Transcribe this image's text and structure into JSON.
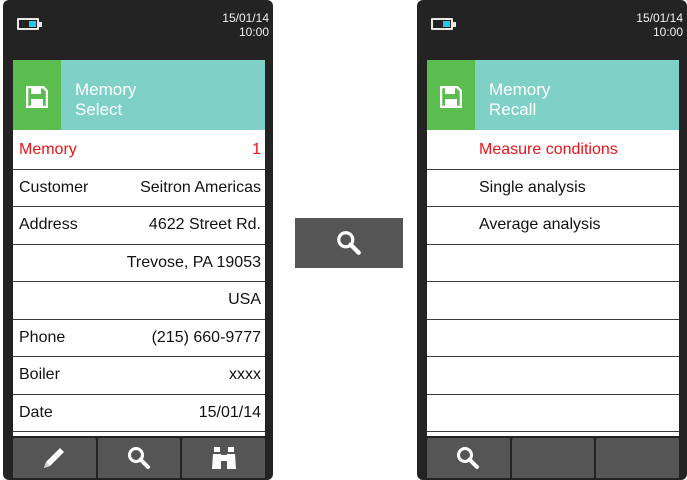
{
  "left_screen": {
    "status": {
      "date": "15/01/14",
      "time": "10:00",
      "battery_icon": "battery-icon"
    },
    "header": {
      "line1": "Memory",
      "line2": "Select",
      "icon": "floppy-disk-icon"
    },
    "rows": [
      {
        "label": "Memory",
        "value": "1",
        "highlighted": true
      },
      {
        "label": "Customer",
        "value": "Seitron Americas"
      },
      {
        "label": "Address",
        "value": "4622 Street Rd."
      },
      {
        "label": "",
        "value": "Trevose, PA 19053"
      },
      {
        "label": "",
        "value": "USA"
      },
      {
        "label": "Phone",
        "value": "(215) 660-9777"
      },
      {
        "label": "Boiler",
        "value": "xxxx"
      },
      {
        "label": "Date",
        "value": "15/01/14"
      }
    ],
    "softkeys": [
      "pencil-icon",
      "search-icon",
      "binoculars-icon"
    ]
  },
  "center_button": {
    "icon": "search-icon"
  },
  "right_screen": {
    "status": {
      "date": "15/01/14",
      "time": "10:00",
      "battery_icon": "battery-icon"
    },
    "header": {
      "line1": "Memory",
      "line2": "Recall",
      "icon": "floppy-disk-icon"
    },
    "items": [
      {
        "label": "Measure conditions",
        "highlighted": true
      },
      {
        "label": "Single analysis"
      },
      {
        "label": "Average analysis"
      },
      {
        "label": ""
      },
      {
        "label": ""
      },
      {
        "label": ""
      },
      {
        "label": ""
      },
      {
        "label": ""
      }
    ],
    "softkeys": [
      "search-icon",
      "",
      ""
    ]
  },
  "colors": {
    "device_body": "#232323",
    "header_teal": "#7fd1c8",
    "header_green": "#5bbc4f",
    "highlight_red": "#e8141b",
    "softkey_gray": "#555555"
  }
}
